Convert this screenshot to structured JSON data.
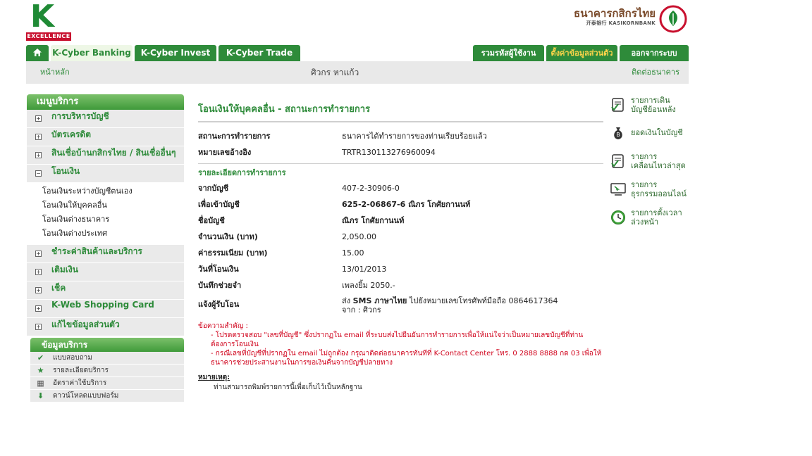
{
  "logo": {
    "letter": "K",
    "tagline": "EXCELLENCE"
  },
  "bank": {
    "name_th": "ธนาคารกสิกรไทย",
    "name_en": "开泰银行 KASIKORNBANK"
  },
  "tabs": {
    "left": [
      "K-Cyber Banking",
      "K-Cyber Invest",
      "K-Cyber Trade"
    ],
    "right": [
      "รวมรหัสผู้ใช้งาน",
      "ตั้งค่าข้อมูลส่วนตัว",
      "ออกจากระบบ"
    ]
  },
  "subnav": {
    "home": "หน้าหลัก",
    "user": "ศิวกร หาแก้ว",
    "contact": "ติดต่อธนาคาร"
  },
  "sidebar": {
    "title": "เมนูบริการ",
    "items_top": [
      {
        "label": "การบริหารบัญชี",
        "sign": "+"
      },
      {
        "label": "บัตรเครดิต",
        "sign": "+"
      },
      {
        "label": "สินเชื่อบ้านกสิกรไทย / สินเชื่ออื่นๆ",
        "sign": "+"
      },
      {
        "label": "โอนเงิน",
        "sign": "−"
      }
    ],
    "sub_items": [
      "โอนเงินระหว่างบัญชีตนเอง",
      "โอนเงินให้บุคคลอื่น",
      "โอนเงินต่างธนาคาร",
      "โอนเงินต่างประเทศ"
    ],
    "items_bottom": [
      {
        "label": "ชำระค่าสินค้าและบริการ",
        "sign": "+"
      },
      {
        "label": "เติมเงิน",
        "sign": "+"
      },
      {
        "label": "เช็ค",
        "sign": "+"
      },
      {
        "label": "K-Web Shopping Card",
        "sign": "+"
      },
      {
        "label": "แก้ไขข้อมูลส่วนตัว",
        "sign": "+"
      }
    ]
  },
  "info": {
    "title": "ข้อมูลบริการ",
    "items": [
      {
        "label": "แบบสอบถาม",
        "icon": "check-icon"
      },
      {
        "label": "รายละเอียดบริการ",
        "icon": "star-icon"
      },
      {
        "label": "อัตราค่าใช้บริการ",
        "icon": "calculator-icon"
      },
      {
        "label": "ดาวน์โหลดแบบฟอร์ม",
        "icon": "download-icon"
      }
    ]
  },
  "main": {
    "title": "โอนเงินให้บุคคลอื่น - สถานะการทำรายการ",
    "status_rows": [
      {
        "label": "สถานะการทำรายการ",
        "value": "ธนาคารได้ทำรายการของท่านเรียบร้อยแล้ว"
      },
      {
        "label": "หมายเลขอ้างอิง",
        "value": "TRTR130113276960094"
      }
    ],
    "detail_title": "รายละเอียดการทำรายการ",
    "detail_rows": [
      {
        "label": "จากบัญชี",
        "value": "407-2-30906-0",
        "bold": false
      },
      {
        "label": "เพื่อเข้าบัญชี",
        "value": "625-2-06867-6 ณิภร โกศัยกานนท์",
        "bold": true
      },
      {
        "label": "ชื่อบัญชี",
        "value": "ณิภร โกศัยกานนท์",
        "bold": true
      },
      {
        "label": "จำนวนเงิน (บาท)",
        "value": "2,050.00",
        "bold": false
      },
      {
        "label": "ค่าธรรมเนียม (บาท)",
        "value": "15.00",
        "bold": false
      },
      {
        "label": "วันที่โอนเงิน",
        "value": "13/01/2013",
        "bold": false
      },
      {
        "label": "บันทึกช่วยจำ",
        "value": "เพลงยิ้ม 2050.-",
        "bold": false
      }
    ],
    "notify": {
      "label": "แจ้งผู้รับโอน",
      "line1_pre": "ส่ง ",
      "line1_bold": "SMS ภาษาไทย",
      "line1_post": " ไปยังหมายเลขโทรศัพท์มือถือ 0864617364",
      "line2": "จาก : ศิวกร"
    },
    "notice": {
      "title": "ข้อความสำคัญ :",
      "line1": "- โปรดตรวจสอบ \"เลขที่บัญชี\" ซึ่งปรากฏใน email ที่ระบบส่งไปยืนยันการทำรายการเพื่อให้แน่ใจว่าเป็นหมายเลขบัญชีที่ท่านต้องการโอนเงิน",
      "line2": "- กรณีเลขที่บัญชีที่ปรากฏใน email ไม่ถูกต้อง กรุณาติดต่อธนาคารทันทีที่ K-Contact Center โทร. 0 2888 8888 กด 03 เพื่อให้ธนาคารช่วยประสานงานในการขอเงินคืนจากบัญชีปลายทาง"
    },
    "remark": {
      "title": "หมายเหตุ:",
      "text": "ท่านสามารถพิมพ์รายการนี้เพื่อเก็บไว้เป็นหลักฐาน"
    }
  },
  "quick": [
    {
      "line1": "รายการเดิน",
      "line2": "บัญชีย้อนหลัง",
      "icon": "statement-icon"
    },
    {
      "line1": "ยอดเงินในบัญชี",
      "line2": "",
      "icon": "money-bag-icon"
    },
    {
      "line1": "รายการ",
      "line2": "เคลื่อนไหวล่าสุด",
      "icon": "recent-icon"
    },
    {
      "line1": "รายการ",
      "line2": "ธุรกรรมออนไลน์",
      "icon": "monitor-icon"
    },
    {
      "line1": "รายการตั้งเวลา",
      "line2": "ล่วงหน้า",
      "icon": "clock-icon"
    }
  ],
  "colors": {
    "brand_green": "#2e8b3a",
    "alert_red": "#d0021b",
    "tab_highlight": "#ffd54a"
  }
}
